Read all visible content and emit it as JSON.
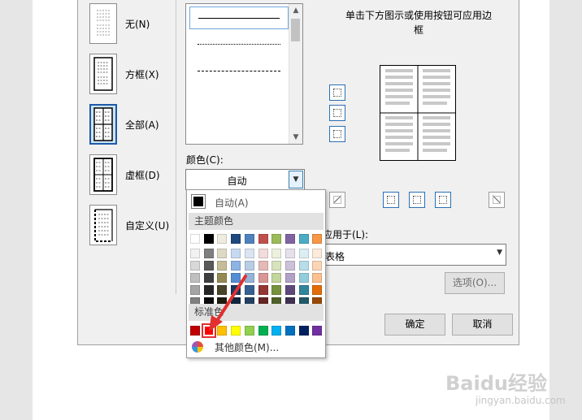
{
  "settings": [
    {
      "label": "无(N)",
      "thumb": "none"
    },
    {
      "label": "方框(X)",
      "thumb": "box"
    },
    {
      "label": "全部(A)",
      "thumb": "all"
    },
    {
      "label": "虚框(D)",
      "thumb": "grid"
    },
    {
      "label": "自定义(U)",
      "thumb": "custom"
    }
  ],
  "border_style": {
    "styles": [
      "solid",
      "dotted",
      "dashed-small",
      "dashed",
      "dash-dot"
    ],
    "selected_index": 0
  },
  "color": {
    "label": "颜色(C):",
    "value": "自动"
  },
  "preview": {
    "instruction": "单击下方图示或使用按钮可应用边框"
  },
  "apply_to": {
    "label": "应用于(L):",
    "value": "表格"
  },
  "buttons": {
    "options": "选项(O)...",
    "ok": "确定",
    "cancel": "取消"
  },
  "color_popup": {
    "auto_label": "自动(A)",
    "theme_heading": "主题颜色",
    "theme_colors": [
      [
        "#ffffff",
        "#f2f2f2",
        "#d8d8d8",
        "#bfbfbf",
        "#a5a5a5",
        "#7f7f7f"
      ],
      [
        "#000000",
        "#7f7f7f",
        "#595959",
        "#3f3f3f",
        "#262626",
        "#0c0c0c"
      ],
      [
        "#eeece1",
        "#ddd9c3",
        "#c4bd97",
        "#938953",
        "#494429",
        "#1d1b10"
      ],
      [
        "#1f497d",
        "#c6d9f0",
        "#8db3e2",
        "#548dd4",
        "#17365d",
        "#0f243e"
      ],
      [
        "#4f81bd",
        "#dbe5f1",
        "#b8cce4",
        "#95b3d7",
        "#366092",
        "#244061"
      ],
      [
        "#c0504d",
        "#f2dcdb",
        "#e5b9b7",
        "#d99694",
        "#953734",
        "#632423"
      ],
      [
        "#9bbb59",
        "#ebf1dd",
        "#d7e3bc",
        "#c3d69b",
        "#76923c",
        "#4f6128"
      ],
      [
        "#8064a2",
        "#e5e0ec",
        "#ccc1d9",
        "#b2a2c7",
        "#5f497a",
        "#3f3151"
      ],
      [
        "#4bacc6",
        "#dbeef3",
        "#b7dde8",
        "#92cddc",
        "#31859b",
        "#205867"
      ],
      [
        "#f79646",
        "#fdeada",
        "#fbd5b5",
        "#fac08f",
        "#e36c09",
        "#974806"
      ]
    ],
    "standard_heading": "标准色",
    "standard_colors": [
      "#c00000",
      "#ff0000",
      "#ffc000",
      "#ffff00",
      "#92d050",
      "#00b050",
      "#00b0f0",
      "#0070c0",
      "#002060",
      "#7030a0"
    ],
    "standard_selected_index": 1,
    "more_label": "其他颜色(M)..."
  },
  "watermark": {
    "text": "Baidu经验",
    "url": "jingyan.baidu.com"
  }
}
